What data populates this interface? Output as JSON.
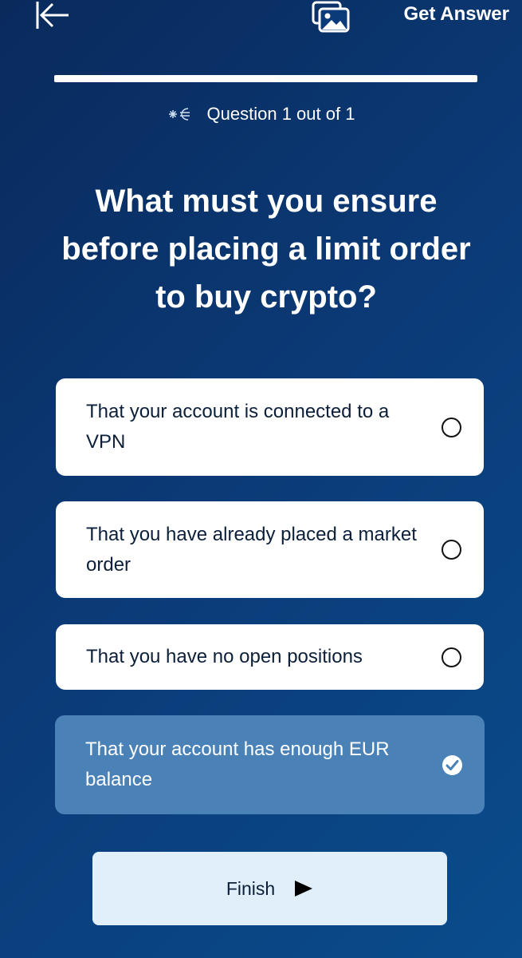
{
  "header": {
    "get_answer_label": "Get Answer"
  },
  "progress": {
    "fraction": 1.0
  },
  "counter": {
    "text": "Question 1 out of 1"
  },
  "question": {
    "text": "What must you ensure before placing a limit order to buy crypto?"
  },
  "options": [
    {
      "label": "That your account is connected to a VPN",
      "selected": false
    },
    {
      "label": "That you have already placed a market order",
      "selected": false
    },
    {
      "label": "That you have no open positions",
      "selected": false
    },
    {
      "label": "That your account has enough EUR balance",
      "selected": true
    }
  ],
  "finish": {
    "label": "Finish"
  },
  "colors": {
    "background_start": "#0a2a5c",
    "background_end": "#0a4c8c",
    "selected_option": "#4a82b8",
    "finish_button": "#e1effa"
  },
  "icons": {
    "back": "arrow-left-bar-icon",
    "gallery": "image-gallery-icon",
    "counter_logo": "brand-logo-icon",
    "finish": "play-triangle-icon",
    "selected": "check-circle-icon"
  }
}
